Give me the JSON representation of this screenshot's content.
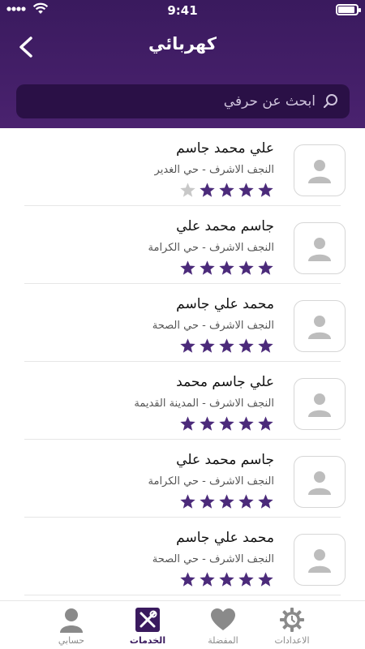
{
  "status": {
    "time": "9:41",
    "battery_level": 0.9
  },
  "header": {
    "title": "كهربائي"
  },
  "search": {
    "placeholder": "ابحث عن حرفي",
    "value": ""
  },
  "items": [
    {
      "name": "علي محمد جاسم",
      "address": "النجف الاشرف - حي الغدير",
      "rating": 4
    },
    {
      "name": "جاسم محمد علي",
      "address": "النجف الاشرف - حي الكرامة",
      "rating": 5
    },
    {
      "name": "محمد علي جاسم",
      "address": "النجف الاشرف - حي الصحة",
      "rating": 5
    },
    {
      "name": "علي جاسم محمد",
      "address": "النجف الاشرف - المدينة القديمة",
      "rating": 5
    },
    {
      "name": "جاسم محمد علي",
      "address": "النجف الاشرف - حي الكرامة",
      "rating": 5
    },
    {
      "name": "محمد علي جاسم",
      "address": "النجف الاشرف - حي الصحة",
      "rating": 5
    }
  ],
  "tabs": [
    {
      "label": "الاعدادات",
      "icon": "gear-icon",
      "active": false
    },
    {
      "label": "المفضلة",
      "icon": "heart-icon",
      "active": false
    },
    {
      "label": "الخدمات",
      "icon": "tools-icon",
      "active": true
    },
    {
      "label": "حسابي",
      "icon": "user-icon",
      "active": false
    }
  ],
  "colors": {
    "primary": "#3a1a5e",
    "star_filled": "#4b2a7a",
    "star_empty": "#c8c8c8"
  }
}
